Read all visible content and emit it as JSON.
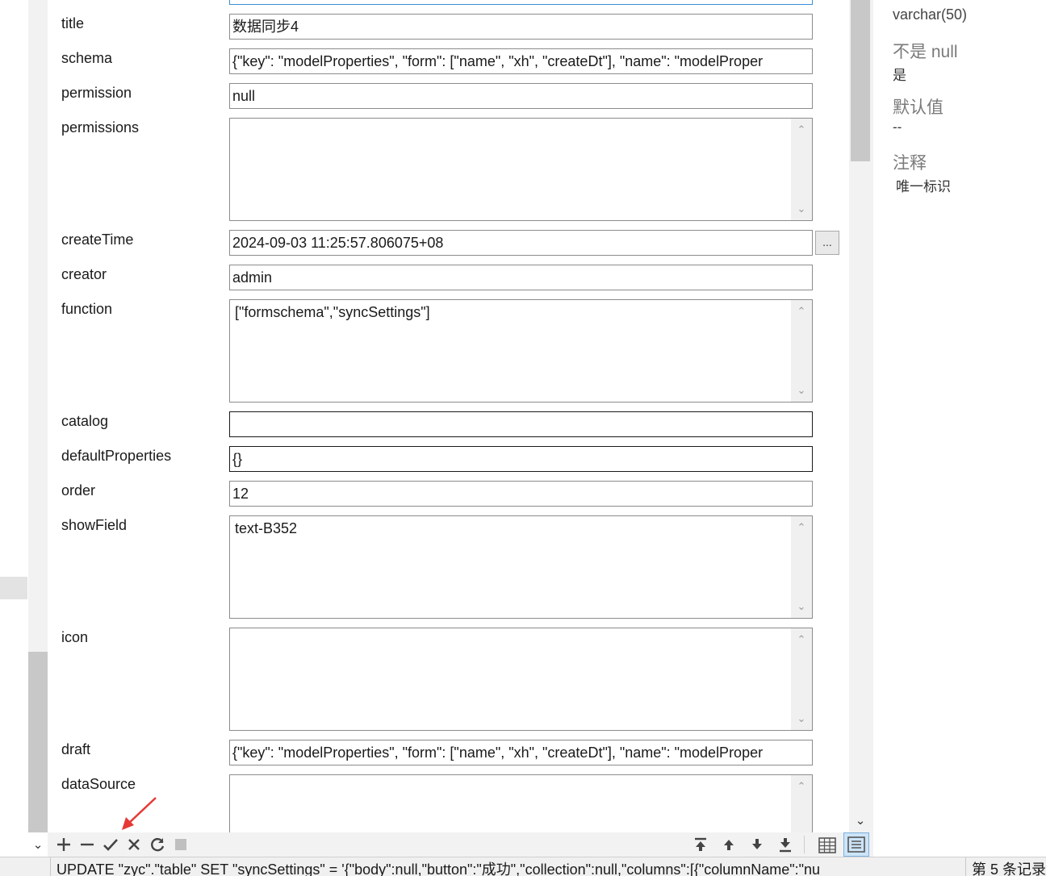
{
  "form": {
    "fields": [
      {
        "label": "title",
        "value": "数据同步4",
        "kind": "input"
      },
      {
        "label": "schema",
        "value": "{\"key\": \"modelProperties\", \"form\": [\"name\", \"xh\", \"createDt\"], \"name\": \"modelProper",
        "kind": "input"
      },
      {
        "label": "permission",
        "value": "null",
        "kind": "input"
      },
      {
        "label": "permissions",
        "value": "",
        "kind": "textarea"
      },
      {
        "label": "createTime",
        "value": "2024-09-03 11:25:57.806075+08",
        "kind": "input",
        "picker_label": "..."
      },
      {
        "label": "creator",
        "value": "admin",
        "kind": "input"
      },
      {
        "label": "function",
        "value": "[\"formschema\",\"syncSettings\"]",
        "kind": "textarea"
      },
      {
        "label": "catalog",
        "value": "",
        "kind": "input"
      },
      {
        "label": "defaultProperties",
        "value": "{}",
        "kind": "input"
      },
      {
        "label": "order",
        "value": "12",
        "kind": "input"
      },
      {
        "label": "showField",
        "value": "text-B352",
        "kind": "textarea"
      },
      {
        "label": "icon",
        "value": "",
        "kind": "textarea"
      },
      {
        "label": "draft",
        "value": "{\"key\": \"modelProperties\", \"form\": [\"name\", \"xh\", \"createDt\"], \"name\": \"modelProper",
        "kind": "input"
      },
      {
        "label": "dataSource",
        "value": "",
        "kind": "textarea"
      }
    ]
  },
  "info": {
    "type_value": "varchar(50)",
    "not_null_title": "不是 null",
    "not_null_value": "是",
    "default_title": "默认值",
    "default_value": "--",
    "comment_title": "注释",
    "comment_value": "唯一标识"
  },
  "toolbar": {
    "icons": [
      "plus-icon",
      "minus-icon",
      "check-icon",
      "close-icon",
      "refresh-icon",
      "stop-icon",
      "first-record-icon",
      "prev-record-icon",
      "next-record-icon",
      "last-record-icon",
      "grid-view-icon",
      "form-view-icon"
    ],
    "accent_color": "#cde4f7"
  },
  "status": {
    "sql": "UPDATE \"zyc\".\"table\" SET \"syncSettings\" = '{\"body\":null,\"button\":\"成功\",\"collection\":null,\"columns\":[{\"columnName\":\"nu",
    "record": "第 5 条记录"
  },
  "annotation": {
    "arrow_color": "#e53935"
  }
}
